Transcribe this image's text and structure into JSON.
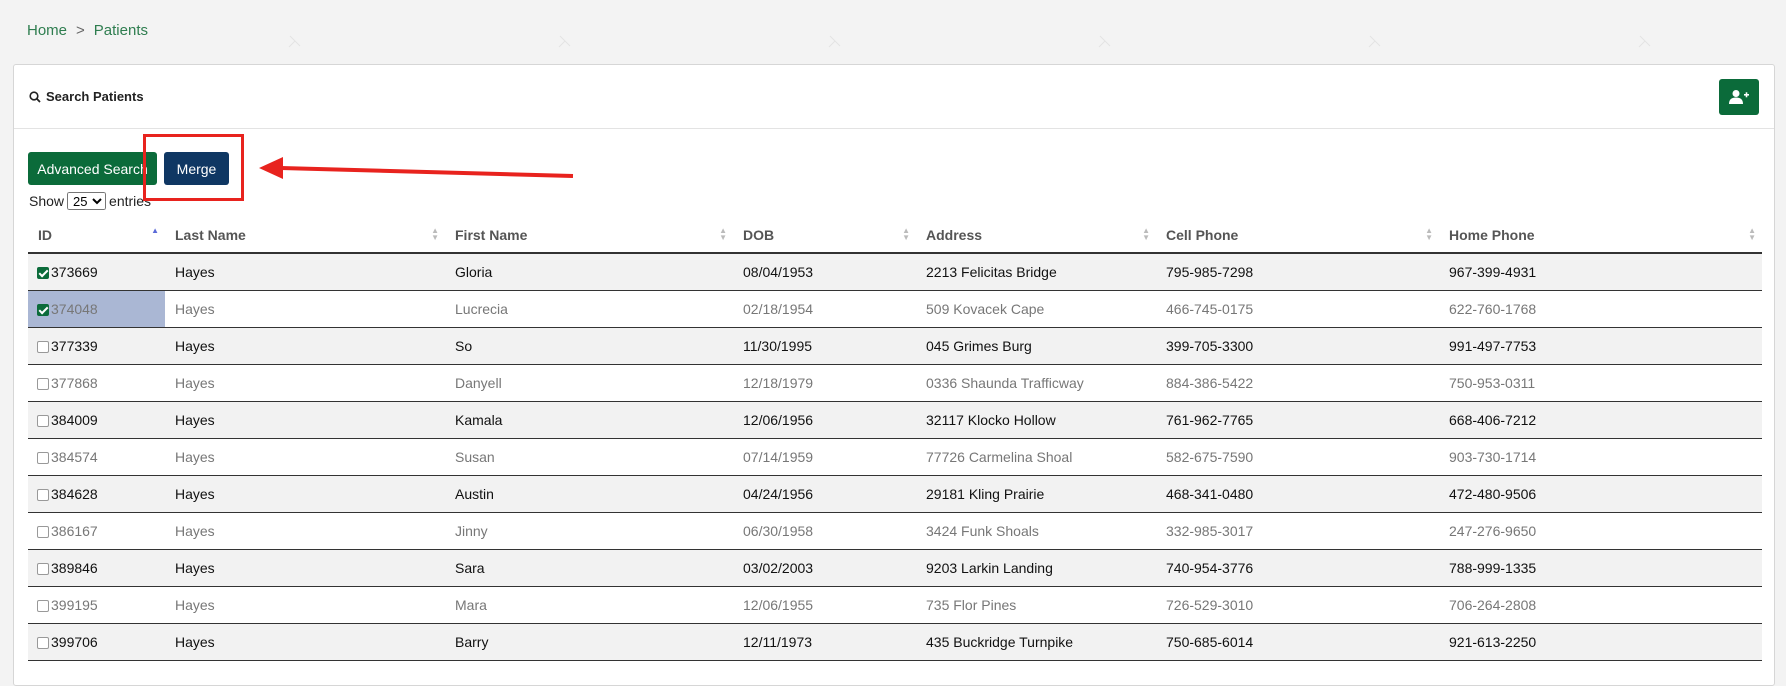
{
  "breadcrumb": {
    "home": "Home",
    "separator": ">",
    "current": "Patients"
  },
  "card": {
    "title": "Search Patients"
  },
  "buttons": {
    "advanced_search": "Advanced Search",
    "merge": "Merge"
  },
  "entries": {
    "show_label": "Show",
    "selected": "25",
    "entries_label": "entries"
  },
  "table": {
    "columns": [
      "ID",
      "Last Name",
      "First Name",
      "DOB",
      "Address",
      "Cell Phone",
      "Home Phone"
    ],
    "sorted_column": "ID",
    "rows": [
      {
        "checked": true,
        "id": "373669",
        "last": "Hayes",
        "first": "Gloria",
        "dob": "08/04/1953",
        "address": "2213 Felicitas Bridge",
        "cell": "795-985-7298",
        "home": "967-399-4931"
      },
      {
        "checked": true,
        "id": "374048",
        "last": "Hayes",
        "first": "Lucrecia",
        "dob": "02/18/1954",
        "address": "509 Kovacek Cape",
        "cell": "466-745-0175",
        "home": "622-760-1768"
      },
      {
        "checked": false,
        "id": "377339",
        "last": "Hayes",
        "first": "So",
        "dob": "11/30/1995",
        "address": "045 Grimes Burg",
        "cell": "399-705-3300",
        "home": "991-497-7753"
      },
      {
        "checked": false,
        "id": "377868",
        "last": "Hayes",
        "first": "Danyell",
        "dob": "12/18/1979",
        "address": "0336 Shaunda Trafficway",
        "cell": "884-386-5422",
        "home": "750-953-0311"
      },
      {
        "checked": false,
        "id": "384009",
        "last": "Hayes",
        "first": "Kamala",
        "dob": "12/06/1956",
        "address": "32117 Klocko Hollow",
        "cell": "761-962-7765",
        "home": "668-406-7212"
      },
      {
        "checked": false,
        "id": "384574",
        "last": "Hayes",
        "first": "Susan",
        "dob": "07/14/1959",
        "address": "77726 Carmelina Shoal",
        "cell": "582-675-7590",
        "home": "903-730-1714"
      },
      {
        "checked": false,
        "id": "384628",
        "last": "Hayes",
        "first": "Austin",
        "dob": "04/24/1956",
        "address": "29181 Kling Prairie",
        "cell": "468-341-0480",
        "home": "472-480-9506"
      },
      {
        "checked": false,
        "id": "386167",
        "last": "Hayes",
        "first": "Jinny",
        "dob": "06/30/1958",
        "address": "3424 Funk Shoals",
        "cell": "332-985-3017",
        "home": "247-276-9650"
      },
      {
        "checked": false,
        "id": "389846",
        "last": "Hayes",
        "first": "Sara",
        "dob": "03/02/2003",
        "address": "9203 Larkin Landing",
        "cell": "740-954-3776",
        "home": "788-999-1335"
      },
      {
        "checked": false,
        "id": "399195",
        "last": "Hayes",
        "first": "Mara",
        "dob": "12/06/1955",
        "address": "735 Flor Pines",
        "cell": "726-529-3010",
        "home": "706-264-2808"
      },
      {
        "checked": false,
        "id": "399706",
        "last": "Hayes",
        "first": "Barry",
        "dob": "12/11/1973",
        "address": "435 Buckridge Turnpike",
        "cell": "750-685-6014",
        "home": "921-613-2250"
      }
    ]
  },
  "colors": {
    "primary_green": "#0b6b3a",
    "navy": "#0f3763",
    "annotation_red": "#e8231e"
  },
  "icons": {
    "search": "search-icon",
    "add_user": "user-plus-icon",
    "sort": "sort-icon"
  }
}
